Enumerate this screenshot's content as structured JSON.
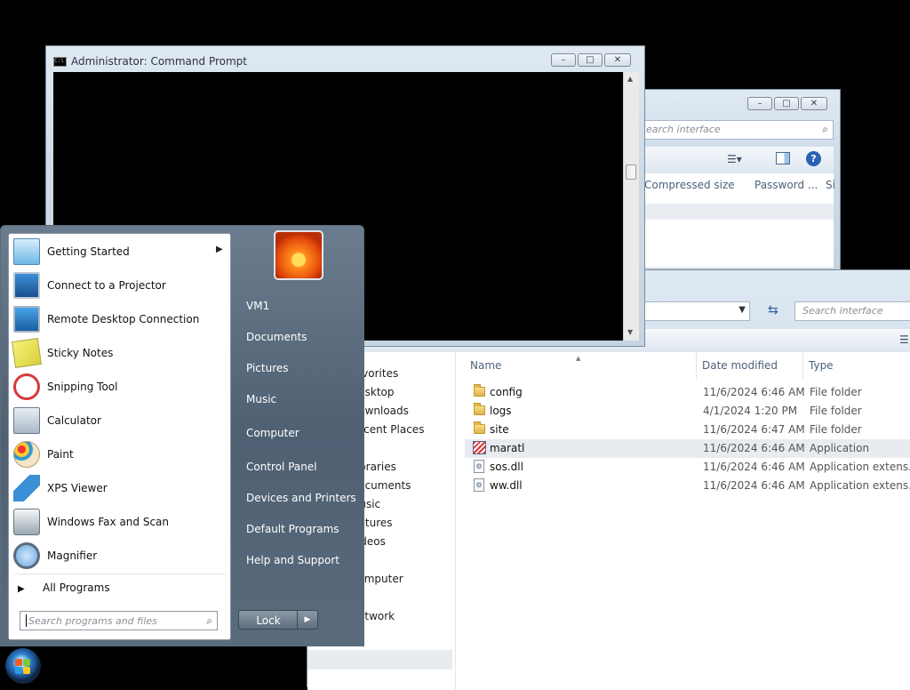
{
  "cmd_window": {
    "title": "Administrator: Command Prompt",
    "icon": "console-icon",
    "controls": {
      "minimize": "minimize-icon",
      "maximize": "maximize-icon",
      "close": "close-icon"
    }
  },
  "explorer_back": {
    "search_placeholder": "Search interface",
    "columns": [
      "Compressed size",
      "Password ...",
      "Si"
    ]
  },
  "explorer_front": {
    "search_placeholder": "Search interface",
    "nav": [
      {
        "label": "Favorites"
      },
      {
        "label": "Desktop"
      },
      {
        "label": "Downloads"
      },
      {
        "label": "Recent Places"
      },
      {
        "label": "Libraries"
      },
      {
        "label": "Documents"
      },
      {
        "label": "Music"
      },
      {
        "label": "Pictures"
      },
      {
        "label": "Videos"
      },
      {
        "label": "Computer"
      },
      {
        "label": "Network"
      }
    ],
    "columns": {
      "name": "Name",
      "date": "Date modified",
      "type": "Type"
    },
    "files": [
      {
        "name": "config",
        "date": "11/6/2024 6:46 AM",
        "type": "File folder",
        "icon": "folder-icon"
      },
      {
        "name": "logs",
        "date": "4/1/2024 1:20 PM",
        "type": "File folder",
        "icon": "folder-icon"
      },
      {
        "name": "site",
        "date": "11/6/2024 6:47 AM",
        "type": "File folder",
        "icon": "folder-icon"
      },
      {
        "name": "maratl",
        "date": "11/6/2024 6:46 AM",
        "type": "Application",
        "icon": "application-icon"
      },
      {
        "name": "sos.dll",
        "date": "11/6/2024 6:46 AM",
        "type": "Application extens...",
        "icon": "dll-file-icon"
      },
      {
        "name": "ww.dll",
        "date": "11/6/2024 6:46 AM",
        "type": "Application extens...",
        "icon": "dll-file-icon"
      }
    ]
  },
  "start_menu": {
    "programs": [
      {
        "label": "Getting Started",
        "icon": "getting-started-icon",
        "submenu": true
      },
      {
        "label": "Connect to a Projector",
        "icon": "projector-icon"
      },
      {
        "label": "Remote Desktop Connection",
        "icon": "remote-desktop-icon"
      },
      {
        "label": "Sticky Notes",
        "icon": "sticky-notes-icon"
      },
      {
        "label": "Snipping Tool",
        "icon": "snipping-tool-icon"
      },
      {
        "label": "Calculator",
        "icon": "calculator-icon"
      },
      {
        "label": "Paint",
        "icon": "paint-icon"
      },
      {
        "label": "XPS Viewer",
        "icon": "xps-viewer-icon"
      },
      {
        "label": "Windows Fax and Scan",
        "icon": "fax-scan-icon"
      },
      {
        "label": "Magnifier",
        "icon": "magnifier-icon"
      }
    ],
    "all_programs": "All Programs",
    "search_placeholder": "Search programs and files",
    "right_items": [
      {
        "label": "VM1"
      },
      {
        "label": "Documents"
      },
      {
        "label": "Pictures"
      },
      {
        "label": "Music"
      },
      {
        "label": "Computer"
      },
      {
        "label": "Control Panel"
      },
      {
        "label": "Devices and Printers"
      },
      {
        "label": "Default Programs"
      },
      {
        "label": "Help and Support"
      }
    ],
    "lock_label": "Lock"
  },
  "taskbar": {
    "start_icon": "windows-orb-icon"
  }
}
